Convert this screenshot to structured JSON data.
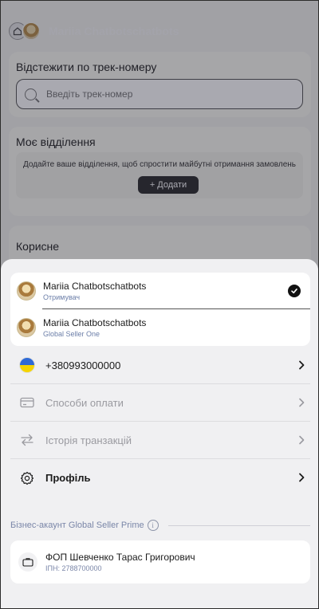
{
  "background": {
    "user_name": "Mariia Chatbotschatbots",
    "track": {
      "title": "Відстежити по трек-номеру",
      "placeholder": "Введіть трек-номер"
    },
    "branch": {
      "title": "Моє відділення",
      "description": "Додайте ваше відділення, щоб спростити майбутні отримання замовлень",
      "add_button": "Додати"
    },
    "useful": {
      "title": "Корисне"
    }
  },
  "sheet": {
    "accounts": [
      {
        "name": "Mariia Chatbotschatbots",
        "role": "Отримувач",
        "selected": true
      },
      {
        "name": "Mariia Chatbotschatbots",
        "role": "Global Seller One",
        "selected": false
      }
    ],
    "menu": [
      {
        "label": "+380993000000",
        "icon": "ukraine-flag-icon",
        "enabled": true
      },
      {
        "label": "Способи оплати",
        "icon": "card-icon",
        "enabled": false
      },
      {
        "label": "Історія транзакцій",
        "icon": "swap-arrows-icon",
        "enabled": false
      },
      {
        "label": "Профіль",
        "icon": "gear-icon",
        "enabled": true
      }
    ],
    "business": {
      "header": "Бізнес-акаунт Global Seller Prime",
      "info_glyph": "i",
      "name": "ФОП Шевченко Тарас Григорович",
      "ipn": "ІПН: 2788700000"
    }
  },
  "colors": {
    "accent_blue_text": "#6b7ea8",
    "flag_blue": "#2f6ad6",
    "flag_yellow": "#f5d400",
    "overlay": "rgba(28,28,48,0.38)"
  }
}
